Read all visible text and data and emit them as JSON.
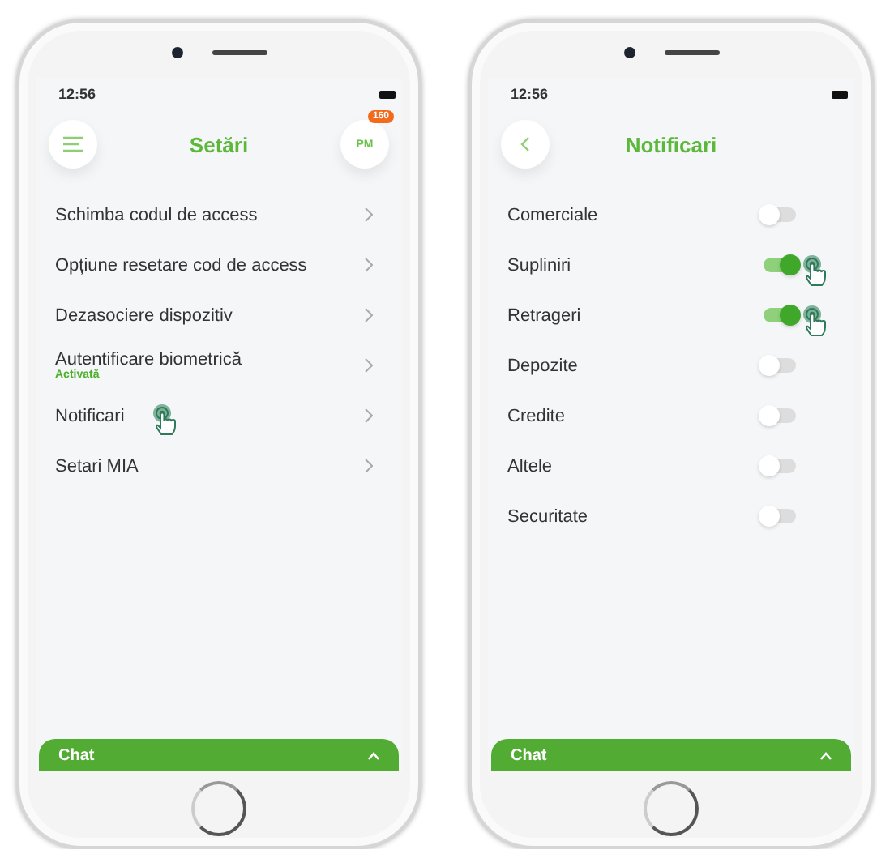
{
  "phones": [
    {
      "screen": {
        "kind": "menu",
        "time": "12:56",
        "title": "Setări",
        "left_button": {
          "kind": "menu"
        },
        "avatar": "PM",
        "badge": "160",
        "chat": "Chat",
        "items": [
          {
            "label": "Schimba codul de access",
            "touched": false
          },
          {
            "label": "Opțiune resetare cod de access",
            "touched": false
          },
          {
            "label": "Dezasociere dispozitiv",
            "touched": false
          },
          {
            "label": "Autentificare biometrică",
            "status": "Activată",
            "touched": false
          },
          {
            "label": "Notificari",
            "touched": true
          },
          {
            "label": "Setari MIA",
            "touched": false
          }
        ]
      }
    },
    {
      "screen": {
        "kind": "toggles",
        "time": "12:56",
        "title": "Notificari",
        "left_button": {
          "kind": "back"
        },
        "chat": "Chat",
        "items": [
          {
            "label": "Comerciale",
            "on": false,
            "touched": false
          },
          {
            "label": "Supliniri",
            "on": true,
            "touched": true
          },
          {
            "label": "Retrageri",
            "on": true,
            "touched": true
          },
          {
            "label": "Depozite",
            "on": false,
            "touched": false
          },
          {
            "label": "Credite",
            "on": false,
            "touched": false
          },
          {
            "label": "Altele",
            "on": false,
            "touched": false
          },
          {
            "label": "Securitate",
            "on": false,
            "touched": false
          }
        ]
      }
    }
  ]
}
